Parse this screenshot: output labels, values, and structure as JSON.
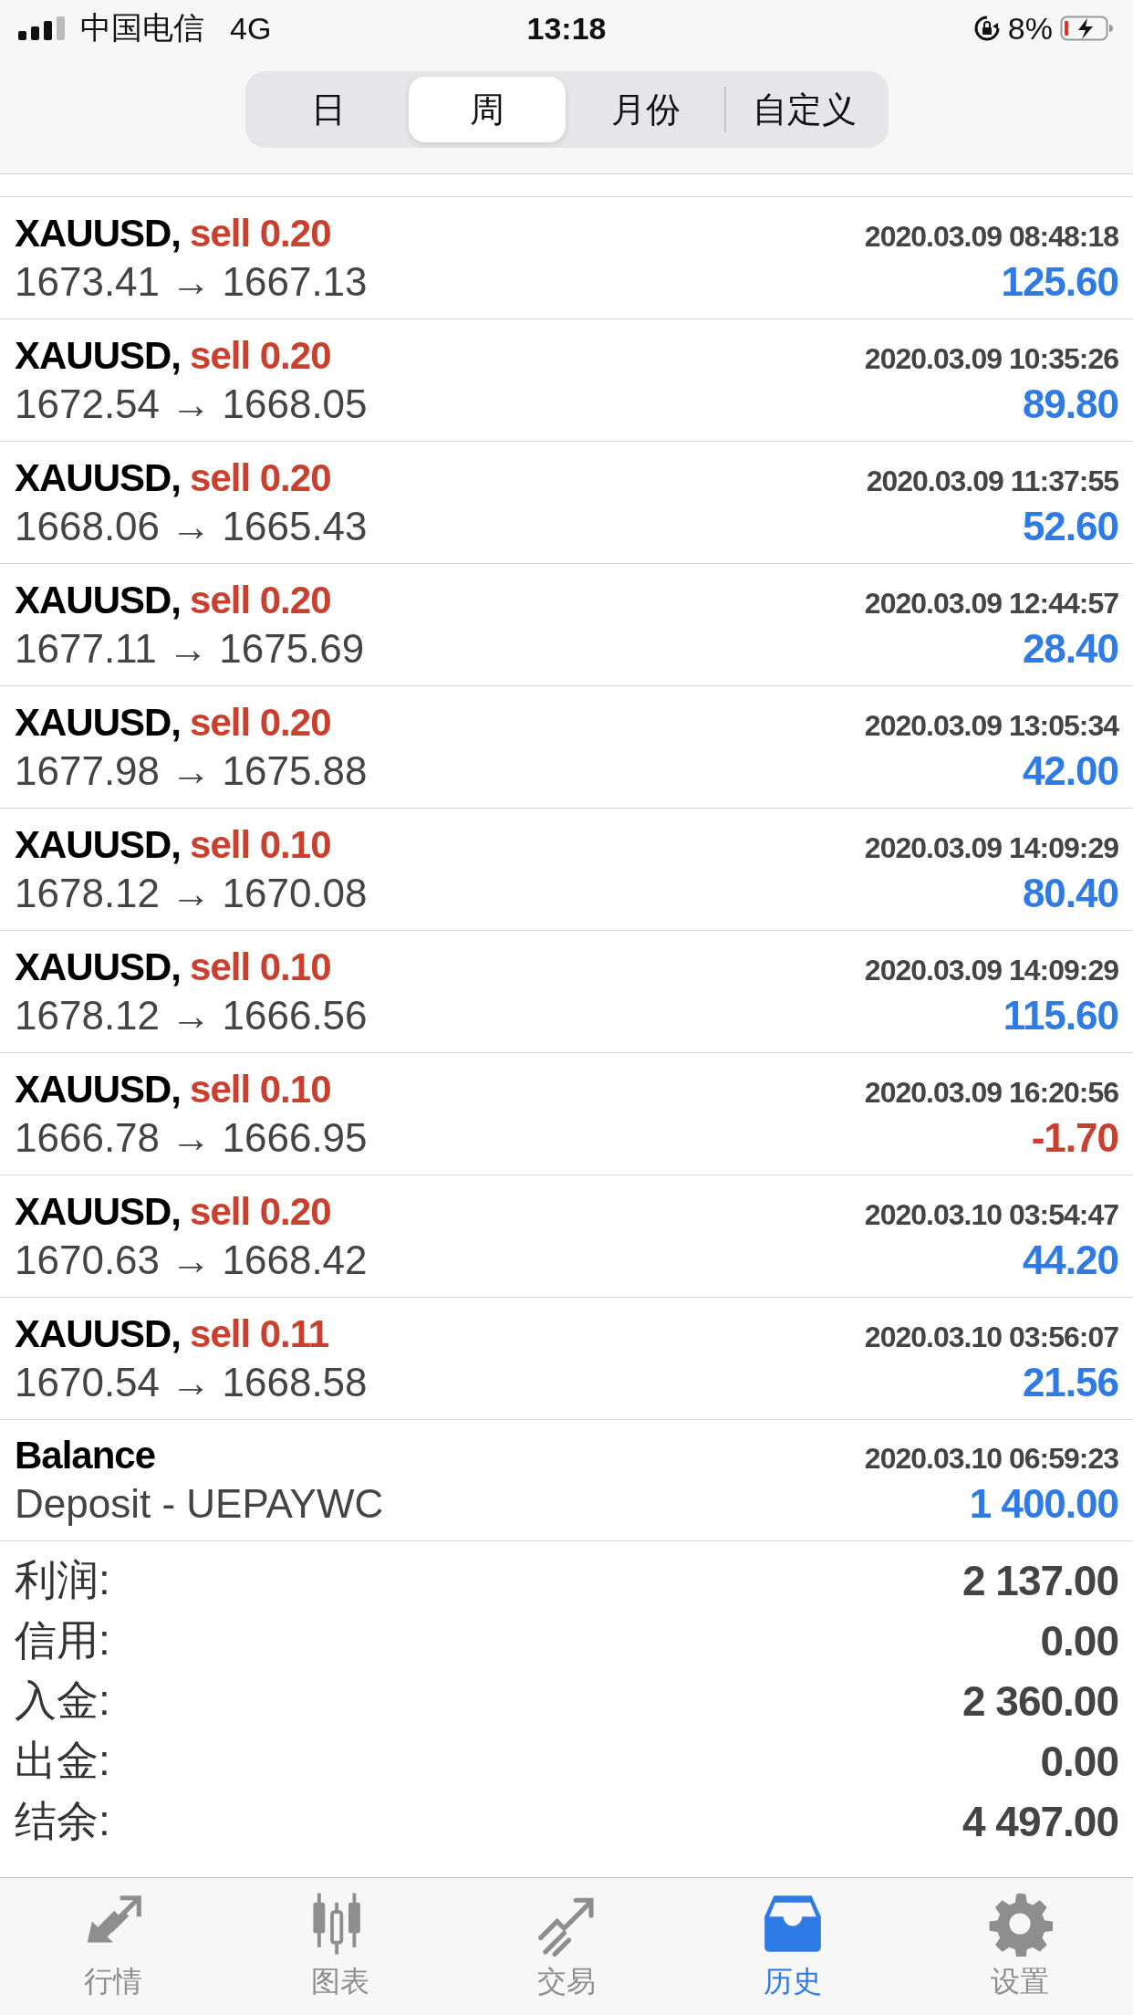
{
  "status_bar": {
    "carrier": "中国电信",
    "network": "4G",
    "time": "13:18",
    "battery": "8%"
  },
  "period_tabs": [
    {
      "label": "日",
      "selected": false
    },
    {
      "label": "周",
      "selected": true
    },
    {
      "label": "月份",
      "selected": false
    },
    {
      "label": "自定义",
      "selected": false
    }
  ],
  "deals": [
    {
      "kind": "trade",
      "symbol": "XAUUSD,",
      "action": "sell 0.20",
      "time": "2020.03.09 08:48:18",
      "prices": "1673.41 → 1667.13",
      "profit": "125.60",
      "color": "#2f7be6"
    },
    {
      "kind": "trade",
      "symbol": "XAUUSD,",
      "action": "sell 0.20",
      "time": "2020.03.09 10:35:26",
      "prices": "1672.54 → 1668.05",
      "profit": "89.80",
      "color": "#2f7be6"
    },
    {
      "kind": "trade",
      "symbol": "XAUUSD,",
      "action": "sell 0.20",
      "time": "2020.03.09 11:37:55",
      "prices": "1668.06 → 1665.43",
      "profit": "52.60",
      "color": "#2f7be6"
    },
    {
      "kind": "trade",
      "symbol": "XAUUSD,",
      "action": "sell 0.20",
      "time": "2020.03.09 12:44:57",
      "prices": "1677.11 → 1675.69",
      "profit": "28.40",
      "color": "#2f7be6"
    },
    {
      "kind": "trade",
      "symbol": "XAUUSD,",
      "action": "sell 0.20",
      "time": "2020.03.09 13:05:34",
      "prices": "1677.98 → 1675.88",
      "profit": "42.00",
      "color": "#2f7be6"
    },
    {
      "kind": "trade",
      "symbol": "XAUUSD,",
      "action": "sell 0.10",
      "time": "2020.03.09 14:09:29",
      "prices": "1678.12 → 1670.08",
      "profit": "80.40",
      "color": "#2f7be6"
    },
    {
      "kind": "trade",
      "symbol": "XAUUSD,",
      "action": "sell 0.10",
      "time": "2020.03.09 14:09:29",
      "prices": "1678.12 → 1666.56",
      "profit": "115.60",
      "color": "#2f7be6"
    },
    {
      "kind": "trade",
      "symbol": "XAUUSD,",
      "action": "sell 0.10",
      "time": "2020.03.09 16:20:56",
      "prices": "1666.78 → 1666.95",
      "profit": "-1.70",
      "color": "#c9402e"
    },
    {
      "kind": "trade",
      "symbol": "XAUUSD,",
      "action": "sell 0.20",
      "time": "2020.03.10 03:54:47",
      "prices": "1670.63 → 1668.42",
      "profit": "44.20",
      "color": "#2f7be6"
    },
    {
      "kind": "trade",
      "symbol": "XAUUSD,",
      "action": "sell 0.11",
      "time": "2020.03.10 03:56:07",
      "prices": "1670.54 → 1668.58",
      "profit": "21.56",
      "color": "#2f7be6"
    },
    {
      "kind": "balance",
      "symbol": "Balance",
      "time": "2020.03.10 06:59:23",
      "prices": "Deposit - UEPAYWC",
      "profit": "1 400.00",
      "color": "#2f7be6"
    }
  ],
  "summary": [
    {
      "label": "利润:",
      "value": "2 137.00"
    },
    {
      "label": "信用:",
      "value": "0.00"
    },
    {
      "label": "入金:",
      "value": "2 360.00"
    },
    {
      "label": "出金:",
      "value": "0.00"
    },
    {
      "label": "结余:",
      "value": "4 497.00"
    }
  ],
  "tab_bar": [
    {
      "label": "行情",
      "kind": "quotes",
      "selected": false
    },
    {
      "label": "图表",
      "kind": "chart",
      "selected": false
    },
    {
      "label": "交易",
      "kind": "trade",
      "selected": false
    },
    {
      "label": "历史",
      "kind": "history",
      "selected": true
    },
    {
      "label": "设置",
      "kind": "settings",
      "selected": false
    }
  ]
}
